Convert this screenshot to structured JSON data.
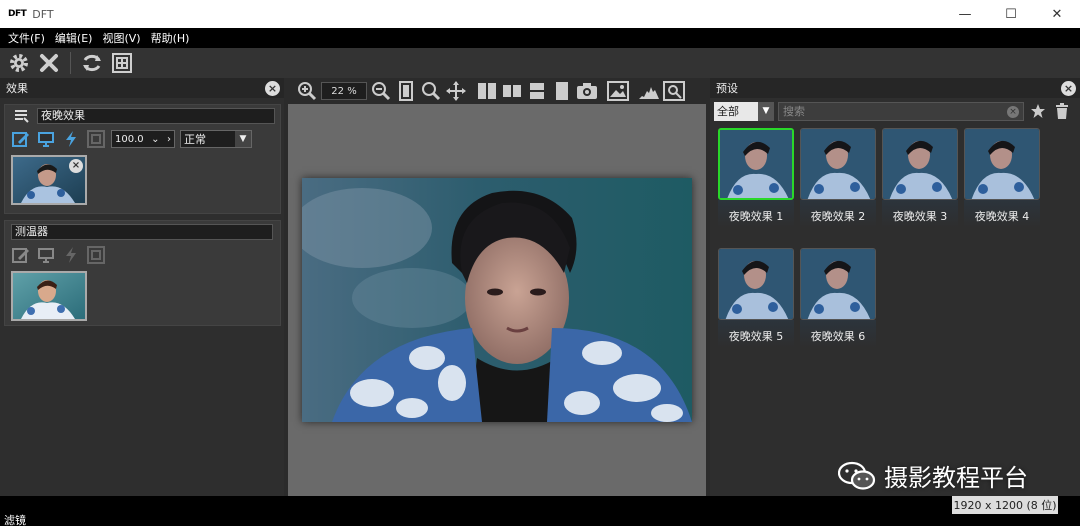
{
  "window": {
    "logo": "DFT",
    "title": "DFT",
    "minimize": "—",
    "maximize": "☐",
    "close": "✕"
  },
  "menu": [
    "文件(F)",
    "编辑(E)",
    "视图(V)",
    "帮助(H)"
  ],
  "effects_panel": {
    "title": "效果",
    "effect1": {
      "name": "夜晚效果",
      "opacity": "100.0",
      "blend_mode": "正常"
    },
    "effect2": {
      "name": "测温器"
    }
  },
  "viewer": {
    "zoom": "22 %"
  },
  "presets_panel": {
    "title": "预设",
    "category": "全部",
    "search_placeholder": "搜索",
    "items": [
      {
        "label": "夜晚效果 1",
        "selected": true
      },
      {
        "label": "夜晚效果 2",
        "selected": false
      },
      {
        "label": "夜晚效果 3",
        "selected": false
      },
      {
        "label": "夜晚效果 4",
        "selected": false
      },
      {
        "label": "夜晚效果 5",
        "selected": false
      },
      {
        "label": "夜晚效果 6",
        "selected": false
      }
    ]
  },
  "watermark": "摄影教程平台",
  "status": {
    "left": "滤镜",
    "dimensions": "1920 x 1200 (8 位)"
  },
  "colors": {
    "selection_border": "#2ad82a",
    "icon": "#cfcfcf",
    "accent_blue": "#4aa3df"
  }
}
